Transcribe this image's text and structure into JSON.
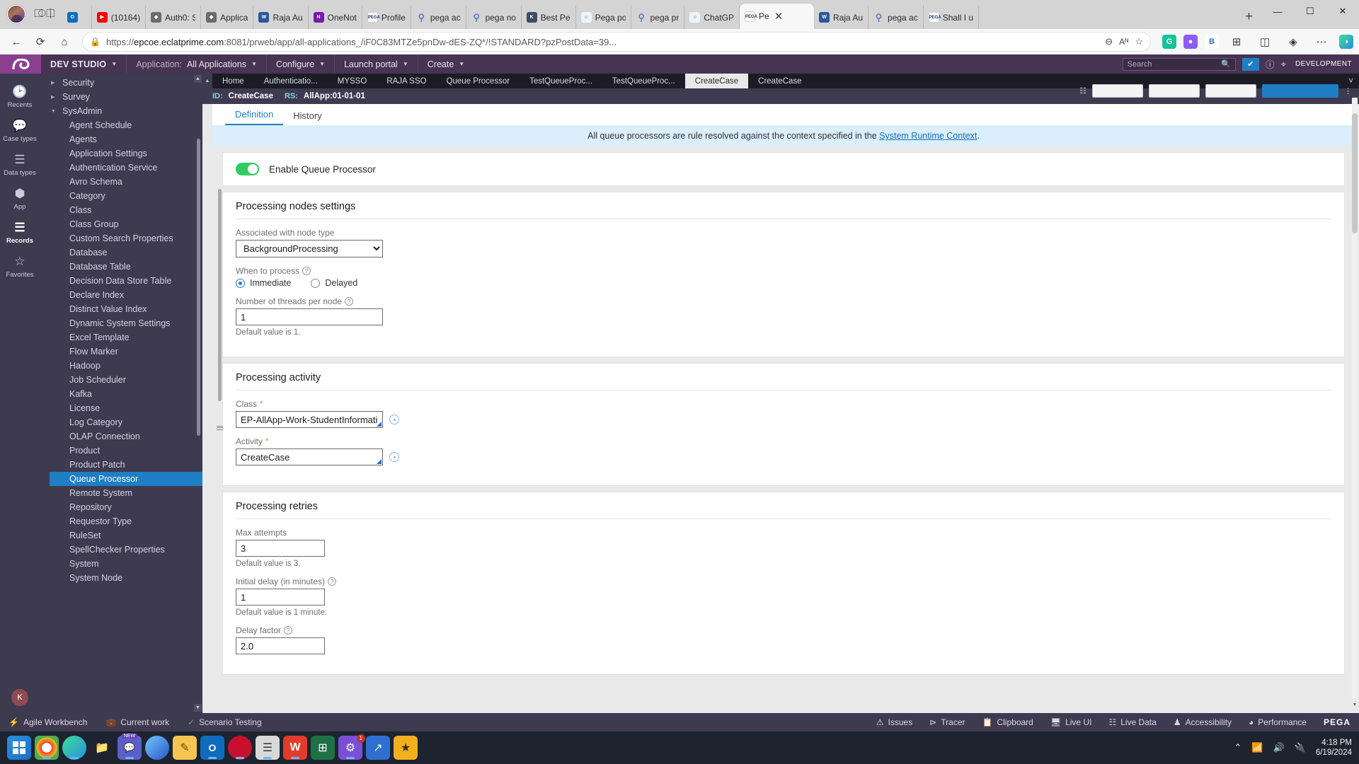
{
  "browser": {
    "tabs": [
      {
        "label": "",
        "icon": "outlook-icon",
        "kind": "outlook"
      },
      {
        "label": "(10164)",
        "icon": "youtube-icon",
        "kind": "yt"
      },
      {
        "label": "Auth0: S",
        "icon": "auth0-icon",
        "kind": "auth0"
      },
      {
        "label": "Applica",
        "icon": "auth0-icon",
        "kind": "auth0"
      },
      {
        "label": "Raja Au",
        "icon": "word-icon",
        "kind": "word"
      },
      {
        "label": "OneNot",
        "icon": "onenote-icon",
        "kind": "onenote"
      },
      {
        "label": "Profile",
        "icon": "pega-icon",
        "kind": "pega"
      },
      {
        "label": "pega ac",
        "icon": "search-icon",
        "kind": "search"
      },
      {
        "label": "pega no",
        "icon": "search-icon",
        "kind": "search"
      },
      {
        "label": "Best Pe",
        "icon": "knowledge-icon",
        "kind": "k"
      },
      {
        "label": "Pega po",
        "icon": "people-icon",
        "kind": "people"
      },
      {
        "label": "pega pr",
        "icon": "search-icon",
        "kind": "search"
      },
      {
        "label": "ChatGP",
        "icon": "chatgpt-icon",
        "kind": "people"
      },
      {
        "label": "Pe",
        "icon": "pega-icon",
        "kind": "pega",
        "active": true
      },
      {
        "label": "Raja Au",
        "icon": "word-icon",
        "kind": "word"
      },
      {
        "label": "pega ac",
        "icon": "search-icon",
        "kind": "search"
      },
      {
        "label": "Shall I u",
        "icon": "pega-icon",
        "kind": "pega"
      }
    ],
    "new_tab_label": "+",
    "close_tab_label": "✕",
    "window_controls": {
      "minimize": "—",
      "maximize": "☐",
      "close": "✕"
    },
    "nav": {
      "back": "←",
      "reload": "⟳",
      "home": "⌂"
    },
    "url": "https://epcoe.eclatprime.com:8081/prweb/app/all-applications_/iF0C83MTZe5pnDw-dES-ZQ*/!STANDARD?pzPostData=39...",
    "url_scheme": "https://",
    "url_host": "epcoe.eclatprime.com",
    "url_rest": ":8081/prweb/app/all-applications_/iF0C83MTZe5pnDw-dES-ZQ*/!STANDARD?pzPostData=39...",
    "lock_icon": "🔒",
    "zoom_icon": "⊖",
    "read_aloud_icon": "Aᴺ",
    "favorite_icon": "☆",
    "collections_icon": "⊞",
    "split_icon": "◫",
    "browser_essentials_icon": "◈",
    "settings_icon": "⋯",
    "copilot_icon": "◑"
  },
  "pega_header": {
    "logo": "pega-logo",
    "studio": "DEV STUDIO",
    "application_label": "Application:",
    "application_value": "All Applications",
    "configure": "Configure",
    "launch_portal": "Launch portal",
    "create": "Create",
    "search_placeholder": "Search",
    "search_icon": "search-icon",
    "check_icon": "✔",
    "help_icon": "?",
    "connections_icon": "connections-icon",
    "environment_badge": "DEVELOPMENT"
  },
  "rail": {
    "items": [
      {
        "label": "Recents",
        "icon": "clock-icon"
      },
      {
        "label": "Case types",
        "icon": "chat-icon"
      },
      {
        "label": "Data types",
        "icon": "database-icon"
      },
      {
        "label": "App",
        "icon": "hexagon-icon"
      },
      {
        "label": "Records",
        "icon": "layers-icon",
        "active": true
      },
      {
        "label": "Favorites",
        "icon": "star-icon"
      }
    ],
    "user_initial": "K"
  },
  "explorer": {
    "groups": [
      {
        "label": "Security",
        "expanded": false
      },
      {
        "label": "Survey",
        "expanded": false
      },
      {
        "label": "SysAdmin",
        "expanded": true
      }
    ],
    "items": [
      "Agent Schedule",
      "Agents",
      "Application Settings",
      "Authentication Service",
      "Avro Schema",
      "Category",
      "Class",
      "Class Group",
      "Custom Search Properties",
      "Database",
      "Database Table",
      "Decision Data Store Table",
      "Declare Index",
      "Distinct Value Index",
      "Dynamic System Settings",
      "Excel Template",
      "Flow Marker",
      "Hadoop",
      "Job Scheduler",
      "Kafka",
      "License",
      "Log Category",
      "OLAP Connection",
      "Product",
      "Product Patch",
      "Queue Processor",
      "Remote System",
      "Repository",
      "Requestor Type",
      "RuleSet",
      "SpellChecker Properties",
      "System",
      "System Node"
    ],
    "selected": "Queue Processor"
  },
  "work_tabs": {
    "tabs": [
      {
        "label": "Home"
      },
      {
        "label": "Authenticatio..."
      },
      {
        "label": "MYSSO"
      },
      {
        "label": "RAJA SSO"
      },
      {
        "label": "Queue Processor"
      },
      {
        "label": "TestQueueProc..."
      },
      {
        "label": "TestQueueProc..."
      },
      {
        "label": "CreateCase",
        "active": true
      },
      {
        "label": "CreateCase"
      }
    ],
    "scroll_up_icon": "▲",
    "collapse_icon": "˅"
  },
  "rule_header": {
    "id_label": "ID:",
    "id_value": "CreateCase",
    "rs_label": "RS:",
    "rs_value": "AllApp:01-01-01"
  },
  "form_tabs": [
    {
      "label": "Definition",
      "active": true
    },
    {
      "label": "History",
      "active": false
    }
  ],
  "notice": {
    "text": "All queue processors are rule resolved against the context specified in the ",
    "link": "System Runtime Context",
    "suffix": "."
  },
  "enable_toggle": {
    "label": "Enable Queue Processor",
    "state": "on",
    "color": "#2fcc62"
  },
  "sections": {
    "nodes": {
      "title": "Processing nodes settings",
      "node_type_label": "Associated with node type",
      "node_type_value": "BackgroundProcessing",
      "when_label": "When to process",
      "when_options": [
        {
          "label": "Immediate",
          "selected": true
        },
        {
          "label": "Delayed",
          "selected": false
        }
      ],
      "threads_label": "Number of threads per node",
      "threads_value": "1",
      "threads_hint": "Default value is 1."
    },
    "activity": {
      "title": "Processing activity",
      "class_label": "Class",
      "class_value": "EP-AllApp-Work-StudentInformation",
      "activity_label": "Activity",
      "activity_value": "CreateCase",
      "required_marker": "*"
    },
    "retries": {
      "title": "Processing retries",
      "max_attempts_label": "Max attempts",
      "max_attempts_value": "3",
      "max_attempts_hint": "Default value is 3.",
      "initial_delay_label": "Initial delay (in minutes)",
      "initial_delay_value": "1",
      "initial_delay_hint": "Default value is 1 minute.",
      "delay_factor_label": "Delay factor",
      "delay_factor_value": "2.0"
    }
  },
  "pega_footer": {
    "left": [
      {
        "label": "Agile Workbench",
        "icon": "bolt-icon"
      },
      {
        "label": "Current work",
        "icon": "briefcase-icon"
      },
      {
        "label": "Scenario Testing",
        "icon": "check-icon"
      }
    ],
    "right": [
      {
        "label": "Issues",
        "icon": "warning-icon"
      },
      {
        "label": "Tracer",
        "icon": "tracer-icon"
      },
      {
        "label": "Clipboard",
        "icon": "clipboard-icon"
      },
      {
        "label": "Live UI",
        "icon": "liveui-icon"
      },
      {
        "label": "Live Data",
        "icon": "livedata-icon"
      },
      {
        "label": "Accessibility",
        "icon": "accessibility-icon"
      },
      {
        "label": "Performance",
        "icon": "gauge-icon"
      }
    ],
    "wordmark": "PEGA"
  },
  "taskbar": {
    "items": [
      {
        "name": "start-button",
        "glyph": "windows-icon"
      },
      {
        "name": "chrome-icon",
        "glyph": "◉"
      },
      {
        "name": "edge-icon",
        "glyph": "◔"
      },
      {
        "name": "file-explorer-icon",
        "glyph": "📁"
      },
      {
        "name": "teams-icon",
        "glyph": "▣",
        "tag": "NEW"
      },
      {
        "name": "edge-dev-icon",
        "glyph": "◑"
      },
      {
        "name": "notepad-icon",
        "glyph": "✎"
      },
      {
        "name": "outlook-icon",
        "glyph": "O"
      },
      {
        "name": "opera-icon",
        "glyph": "●"
      },
      {
        "name": "app-icon",
        "glyph": "☲"
      },
      {
        "name": "wps-icon",
        "glyph": "W"
      },
      {
        "name": "excel-icon",
        "glyph": "⊞"
      },
      {
        "name": "tool-icon",
        "glyph": "⚙",
        "badge": "1"
      },
      {
        "name": "analytics-icon",
        "glyph": "↗"
      },
      {
        "name": "star-icon",
        "glyph": "☆"
      }
    ],
    "tray": {
      "show_hidden_icon": "⌃",
      "wifi_icon": "wifi-icon",
      "volume_icon": "🔊",
      "battery_icon": "battery-icon",
      "time": "4:18 PM",
      "date": "6/19/2024"
    }
  }
}
